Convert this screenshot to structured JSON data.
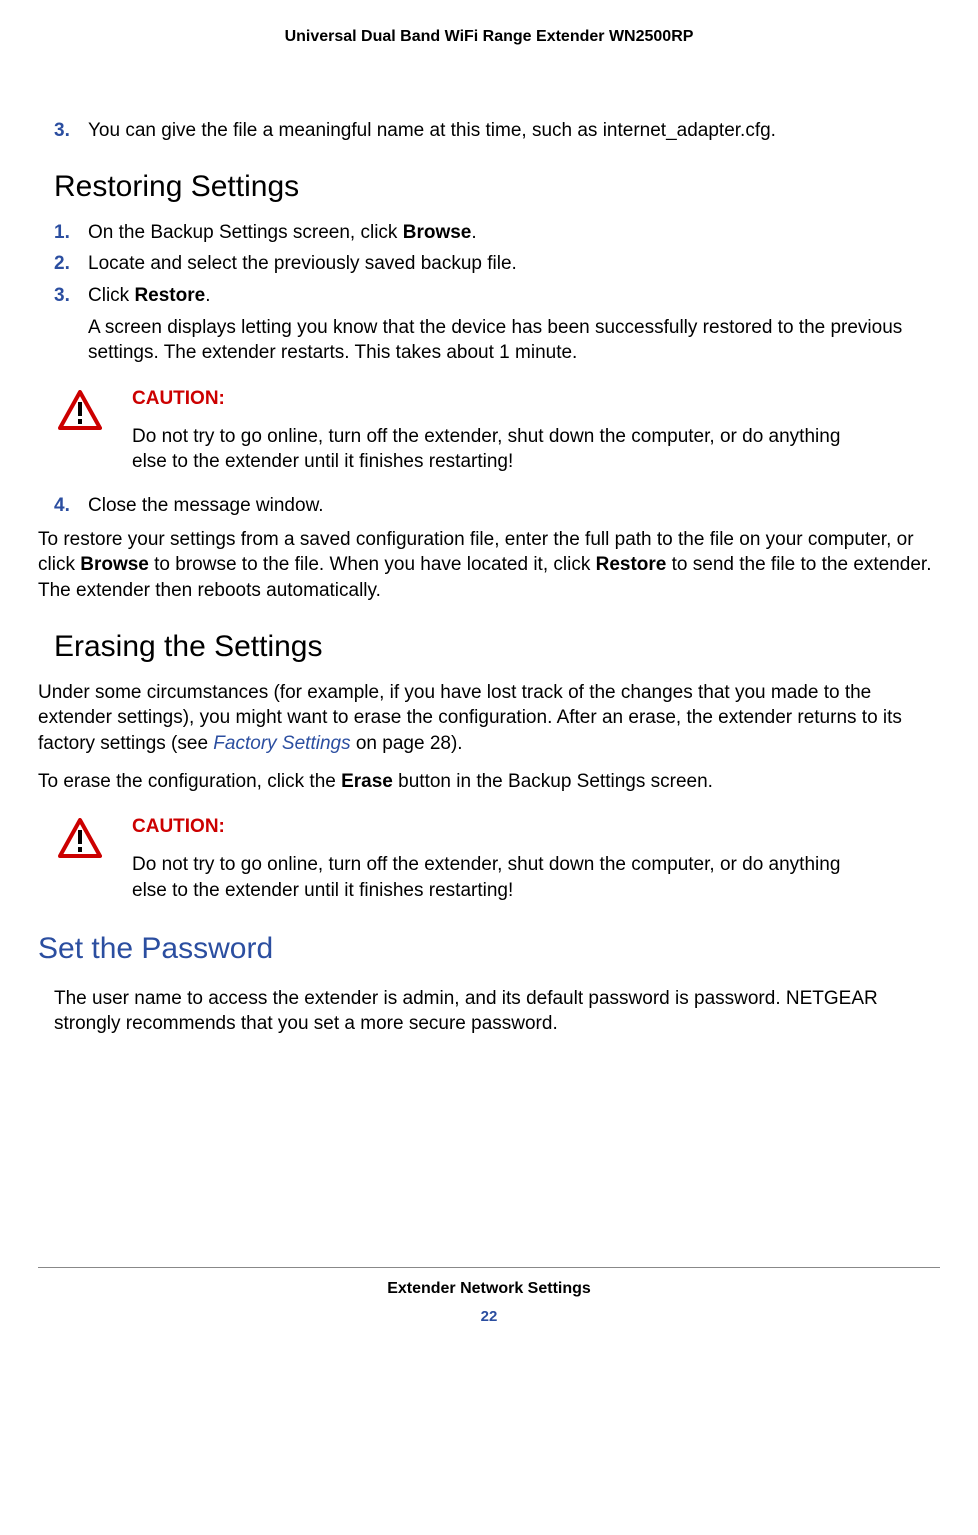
{
  "header": "Universal Dual Band WiFi Range Extender WN2500RP",
  "step3_top": "You can give the file a meaningful name at this time, such as internet_adapter.cfg.",
  "restoring": {
    "heading": "Restoring Settings",
    "s1_pre": "On the Backup Settings screen, click ",
    "s1_bold": "Browse",
    "s1_post": ".",
    "s2": "Locate and select the previously saved backup file.",
    "s3_pre": "Click ",
    "s3_bold": "Restore",
    "s3_post": ".",
    "s3_after": "A screen displays letting you know that the device has been successfully restored to the previous settings. The extender restarts. This takes about 1 minute.",
    "s4": "Close the message window.",
    "para_pre": "To restore your settings from a saved configuration file, enter the full path to the file on your computer, or click ",
    "para_b1": "Browse",
    "para_mid": " to browse to the file. When you have located it, click ",
    "para_b2": "Restore",
    "para_post": " to send the file to the extender. The extender then reboots automatically."
  },
  "caution": {
    "label": "CAUTION:",
    "body": "Do not try to go online, turn off the extender, shut down the computer, or do anything else to the extender until it finishes restarting!"
  },
  "erasing": {
    "heading": "Erasing the Settings",
    "p1_pre": "Under some circumstances (for example, if you have lost track of the changes that you made to the extender settings), you might want to erase the configuration. After an erase, the extender returns to its factory settings (see ",
    "p1_link": "Factory Settings",
    "p1_post": " on page 28).",
    "p2_pre": "To erase the configuration, click the ",
    "p2_bold": "Erase",
    "p2_post": " button in the Backup Settings screen."
  },
  "password": {
    "heading": "Set the Password",
    "body": "The user name to access the extender is admin, and its default password is password. NETGEAR strongly recommends that you set a more secure password."
  },
  "footer": {
    "title": "Extender Network Settings",
    "page": "22"
  },
  "nums": {
    "n1": "1.",
    "n2": "2.",
    "n3": "3.",
    "n4": "4."
  }
}
